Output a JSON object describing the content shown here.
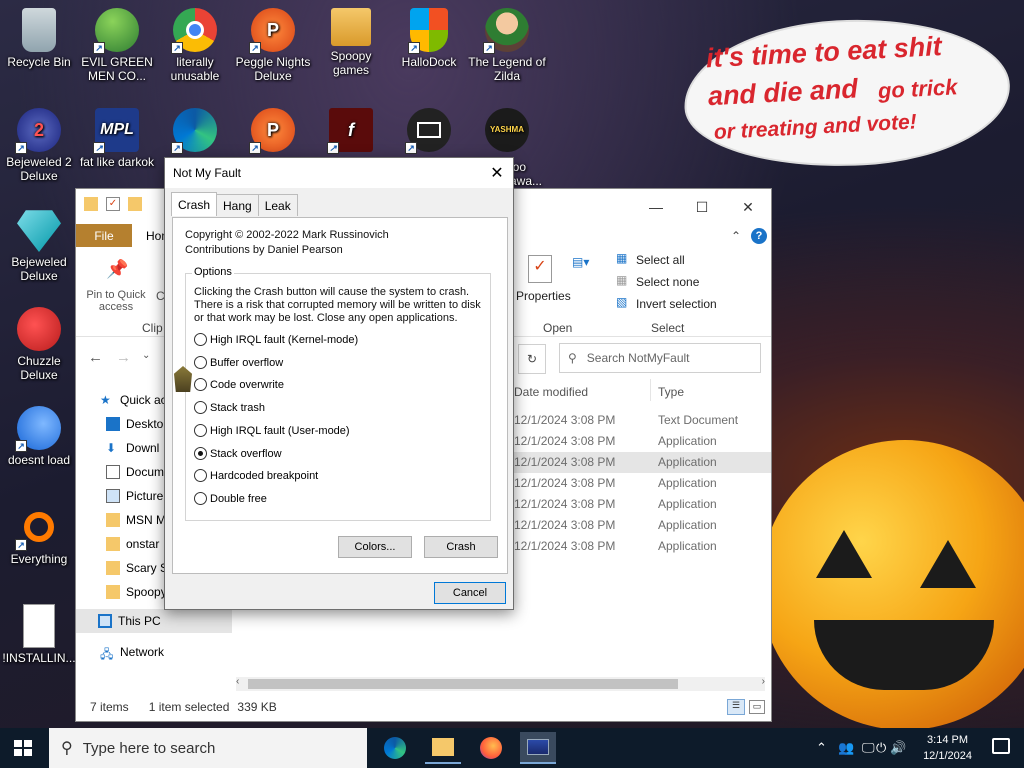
{
  "desktop": {
    "icons": [
      {
        "label": "Recycle Bin"
      },
      {
        "label": "EVIL GREEN MEN CO..."
      },
      {
        "label": "literally unusable"
      },
      {
        "label": "Peggle Nights Deluxe"
      },
      {
        "label": "Spoopy games"
      },
      {
        "label": "HalloDock"
      },
      {
        "label": "The Legend of Zilda"
      },
      {
        "label": "Bejeweled 2 Deluxe"
      },
      {
        "label": "fat like darkok"
      },
      {
        "label": "Bejeweled Deluxe"
      },
      {
        "label": "Chuzzle Deluxe"
      },
      {
        "label": "doesnt load"
      },
      {
        "label": "Everything"
      },
      {
        "label": "!INSTALLIN..."
      }
    ],
    "partial_icon_labels": {
      "boo": "boo",
      "awa": "awa..."
    },
    "yashma_text": "YASHMA",
    "bubble": {
      "line1": "it's time to eat shit",
      "line2a": "and die and",
      "line2b": "go trick",
      "line3": "or treating and vote!"
    },
    "bubble_text_color": "#d9262e"
  },
  "explorer": {
    "file_tab": "File",
    "home_tab": "Hom",
    "pin_label": "Pin to Quick access",
    "clip_partial": "C",
    "clipboard_group": "Clip",
    "properties_label": "Properties",
    "open_group": "Open",
    "select_all": "Select all",
    "select_none": "Select none",
    "invert_selection": "Invert selection",
    "select_group": "Select",
    "search_placeholder": "Search NotMyFault",
    "nav": {
      "quick_access": "Quick ac",
      "desktop": "Deskto",
      "downloads": "Downl",
      "documents": "Docum",
      "pictures": "Picture",
      "msn": "MSN M",
      "onstar": "onstar",
      "scary": "Scary S",
      "spoopy": "Spoopy",
      "this_pc": "This PC",
      "network": "Network"
    },
    "columns": {
      "date": "Date modified",
      "type": "Type"
    },
    "rows": [
      {
        "date": "12/1/2024 3:08 PM",
        "type": "Text Document"
      },
      {
        "date": "12/1/2024 3:08 PM",
        "type": "Application"
      },
      {
        "date": "12/1/2024 3:08 PM",
        "type": "Application"
      },
      {
        "date": "12/1/2024 3:08 PM",
        "type": "Application"
      },
      {
        "date": "12/1/2024 3:08 PM",
        "type": "Application"
      },
      {
        "date": "12/1/2024 3:08 PM",
        "type": "Application"
      },
      {
        "date": "12/1/2024 3:08 PM",
        "type": "Application"
      }
    ],
    "selected_row_index": 2,
    "status": {
      "items": "7 items",
      "selected": "1 item selected",
      "size": "339 KB"
    }
  },
  "dialog": {
    "title": "Not My Fault",
    "tabs": [
      "Crash",
      "Hang",
      "Leak"
    ],
    "copyright": "Copyright © 2002-2022 Mark Russinovich",
    "contributions": "Contributions by Daniel Pearson",
    "options_label": "Options",
    "warning": "Clicking the Crash button will cause the system to crash. There is a risk that corrupted memory will be written to disk or that work may be lost. Close any open applications.",
    "radios": [
      "High IRQL fault (Kernel-mode)",
      "Buffer overflow",
      "Code overwrite",
      "Stack trash",
      "High IRQL fault (User-mode)",
      "Stack overflow",
      "Hardcoded breakpoint",
      "Double free"
    ],
    "selected_radio": "Stack overflow",
    "colors_button": "Colors...",
    "crash_button": "Crash",
    "cancel_button": "Cancel"
  },
  "taskbar": {
    "search_placeholder": "Type here to search",
    "time": "3:14 PM",
    "date": "12/1/2024"
  },
  "colors": {
    "file_tab": "#b5802f",
    "taskbar": "#0d1b2a",
    "pumpkin": "#f6a515"
  }
}
